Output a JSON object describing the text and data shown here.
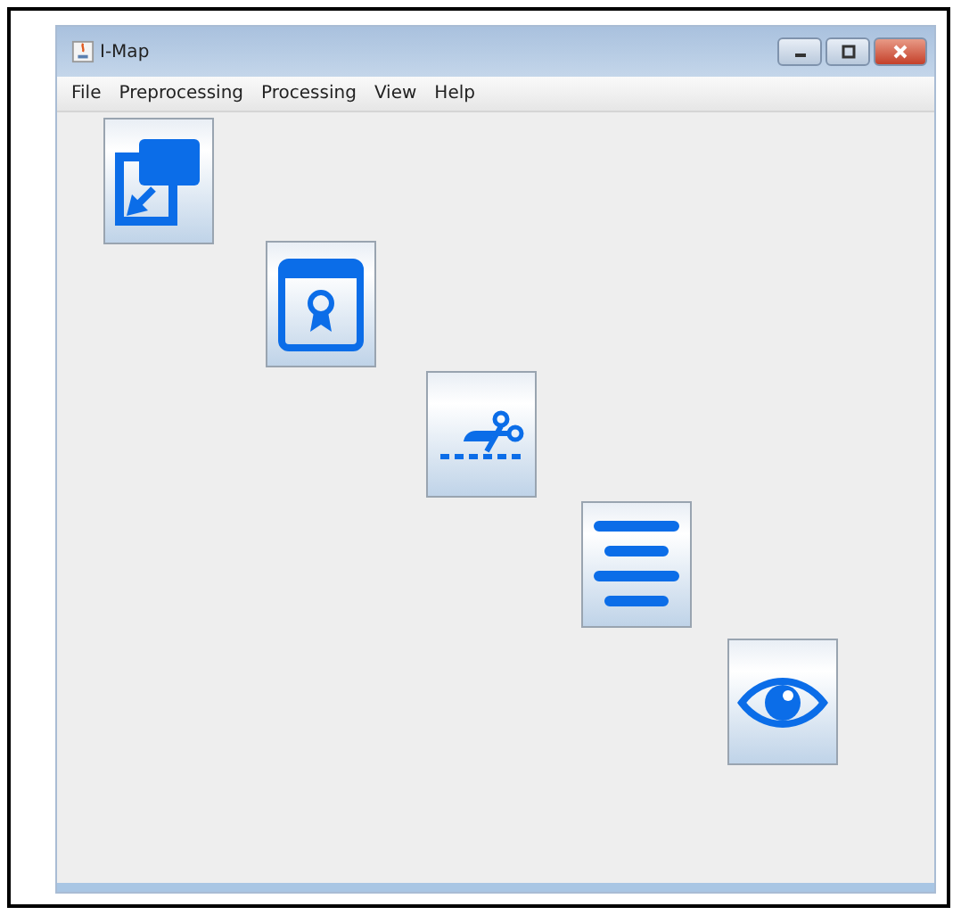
{
  "window": {
    "title": "I-Map"
  },
  "menu": [
    "File",
    "Preprocessing",
    "Processing",
    "View",
    "Help"
  ],
  "tool_buttons": [
    {
      "kind": "import"
    },
    {
      "kind": "certificate"
    },
    {
      "kind": "cut"
    },
    {
      "kind": "list"
    },
    {
      "kind": "view"
    }
  ]
}
